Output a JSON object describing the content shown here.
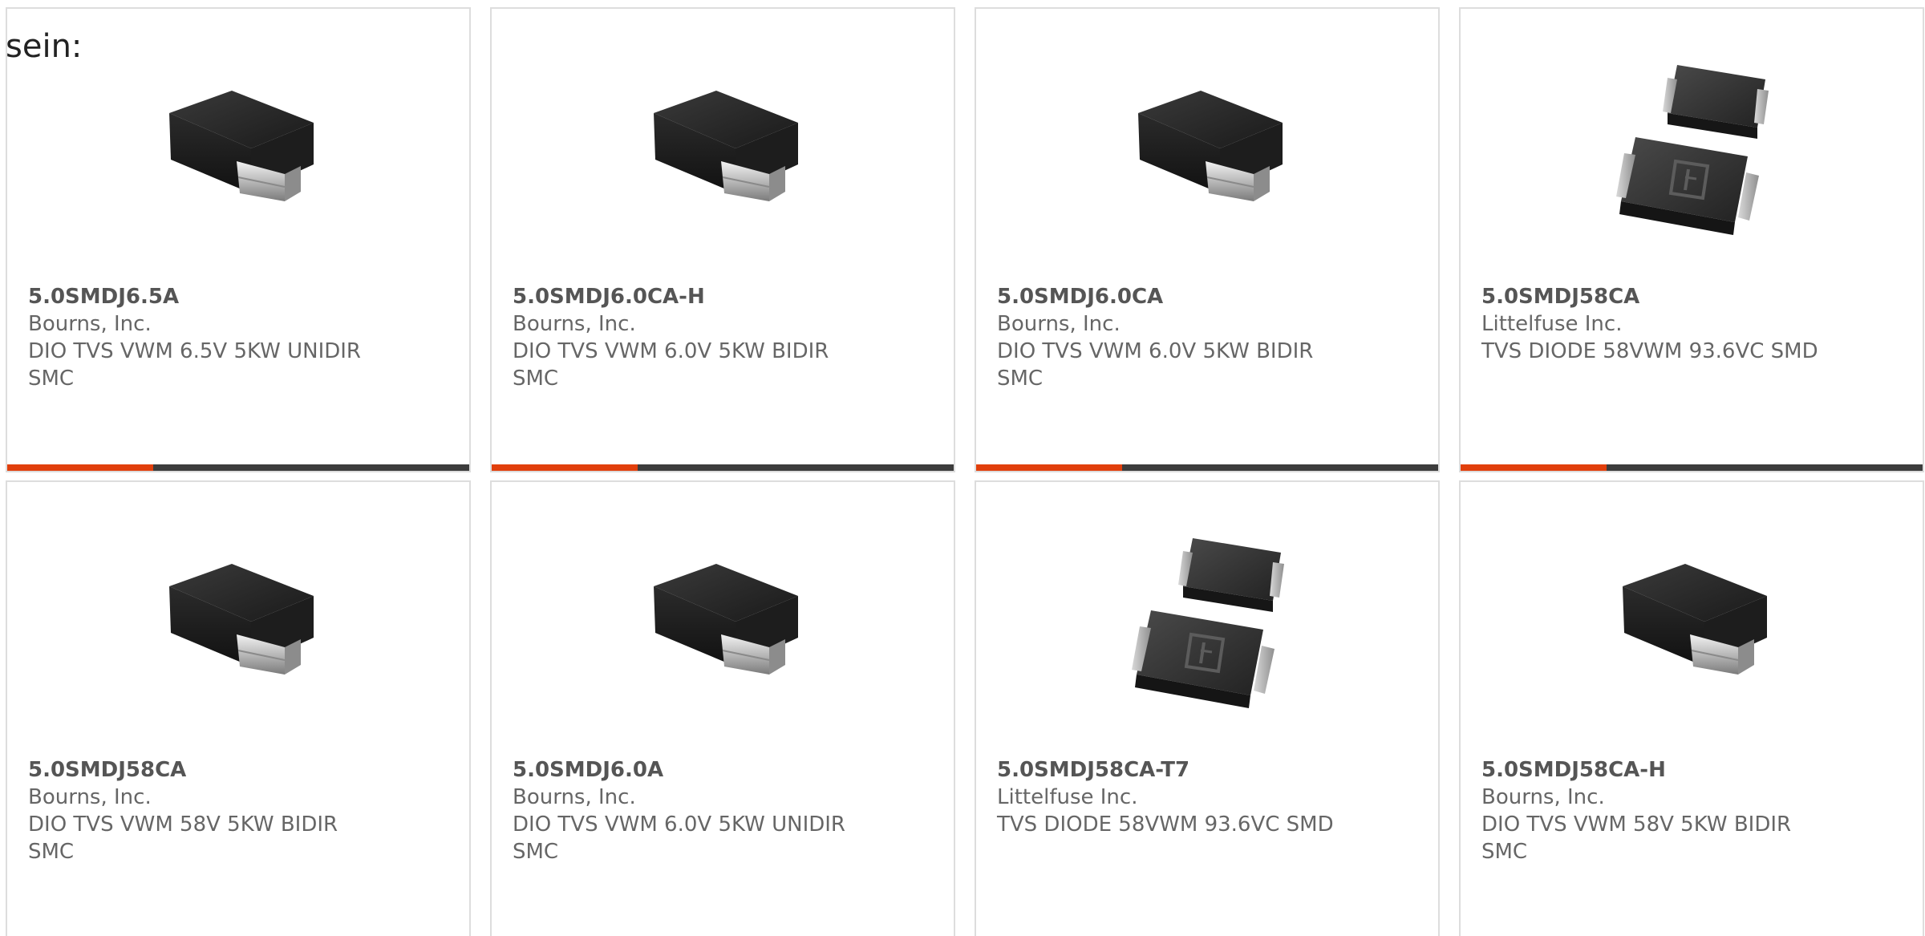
{
  "intro_text": "sein:",
  "colors": {
    "accent": "#e13f0c",
    "bar": "#3c3c3c",
    "border": "#dddddd",
    "part_number": "#555555",
    "body_text": "#666666"
  },
  "products": [
    {
      "part_number": "5.0SMDJ6.5A",
      "manufacturer": "Bourns, Inc.",
      "description": "DIO TVS VWM 6.5V 5KW UNIDIR\nSMC",
      "image": "bourns-smc-diode"
    },
    {
      "part_number": "5.0SMDJ6.0CA-H",
      "manufacturer": "Bourns, Inc.",
      "description": "DIO TVS VWM 6.0V 5KW BIDIR\nSMC",
      "image": "bourns-smc-diode"
    },
    {
      "part_number": "5.0SMDJ6.0CA",
      "manufacturer": "Bourns, Inc.",
      "description": "DIO TVS VWM 6.0V 5KW BIDIR\nSMC",
      "image": "bourns-smc-diode"
    },
    {
      "part_number": "5.0SMDJ58CA",
      "manufacturer": "Littelfuse Inc.",
      "description": "TVS DIODE 58VWM 93.6VC SMD",
      "image": "littelfuse-smd-diode"
    },
    {
      "part_number": "5.0SMDJ58CA",
      "manufacturer": "Bourns, Inc.",
      "description": "DIO TVS VWM 58V 5KW BIDIR\nSMC",
      "image": "bourns-smc-diode"
    },
    {
      "part_number": "5.0SMDJ6.0A",
      "manufacturer": "Bourns, Inc.",
      "description": "DIO TVS VWM 6.0V 5KW UNIDIR\nSMC",
      "image": "bourns-smc-diode"
    },
    {
      "part_number": "5.0SMDJ58CA-T7",
      "manufacturer": "Littelfuse Inc.",
      "description": "TVS DIODE 58VWM 93.6VC SMD",
      "image": "littelfuse-smd-diode"
    },
    {
      "part_number": "5.0SMDJ58CA-H",
      "manufacturer": "Bourns, Inc.",
      "description": "DIO TVS VWM 58V 5KW BIDIR\nSMC",
      "image": "bourns-smc-diode"
    }
  ]
}
